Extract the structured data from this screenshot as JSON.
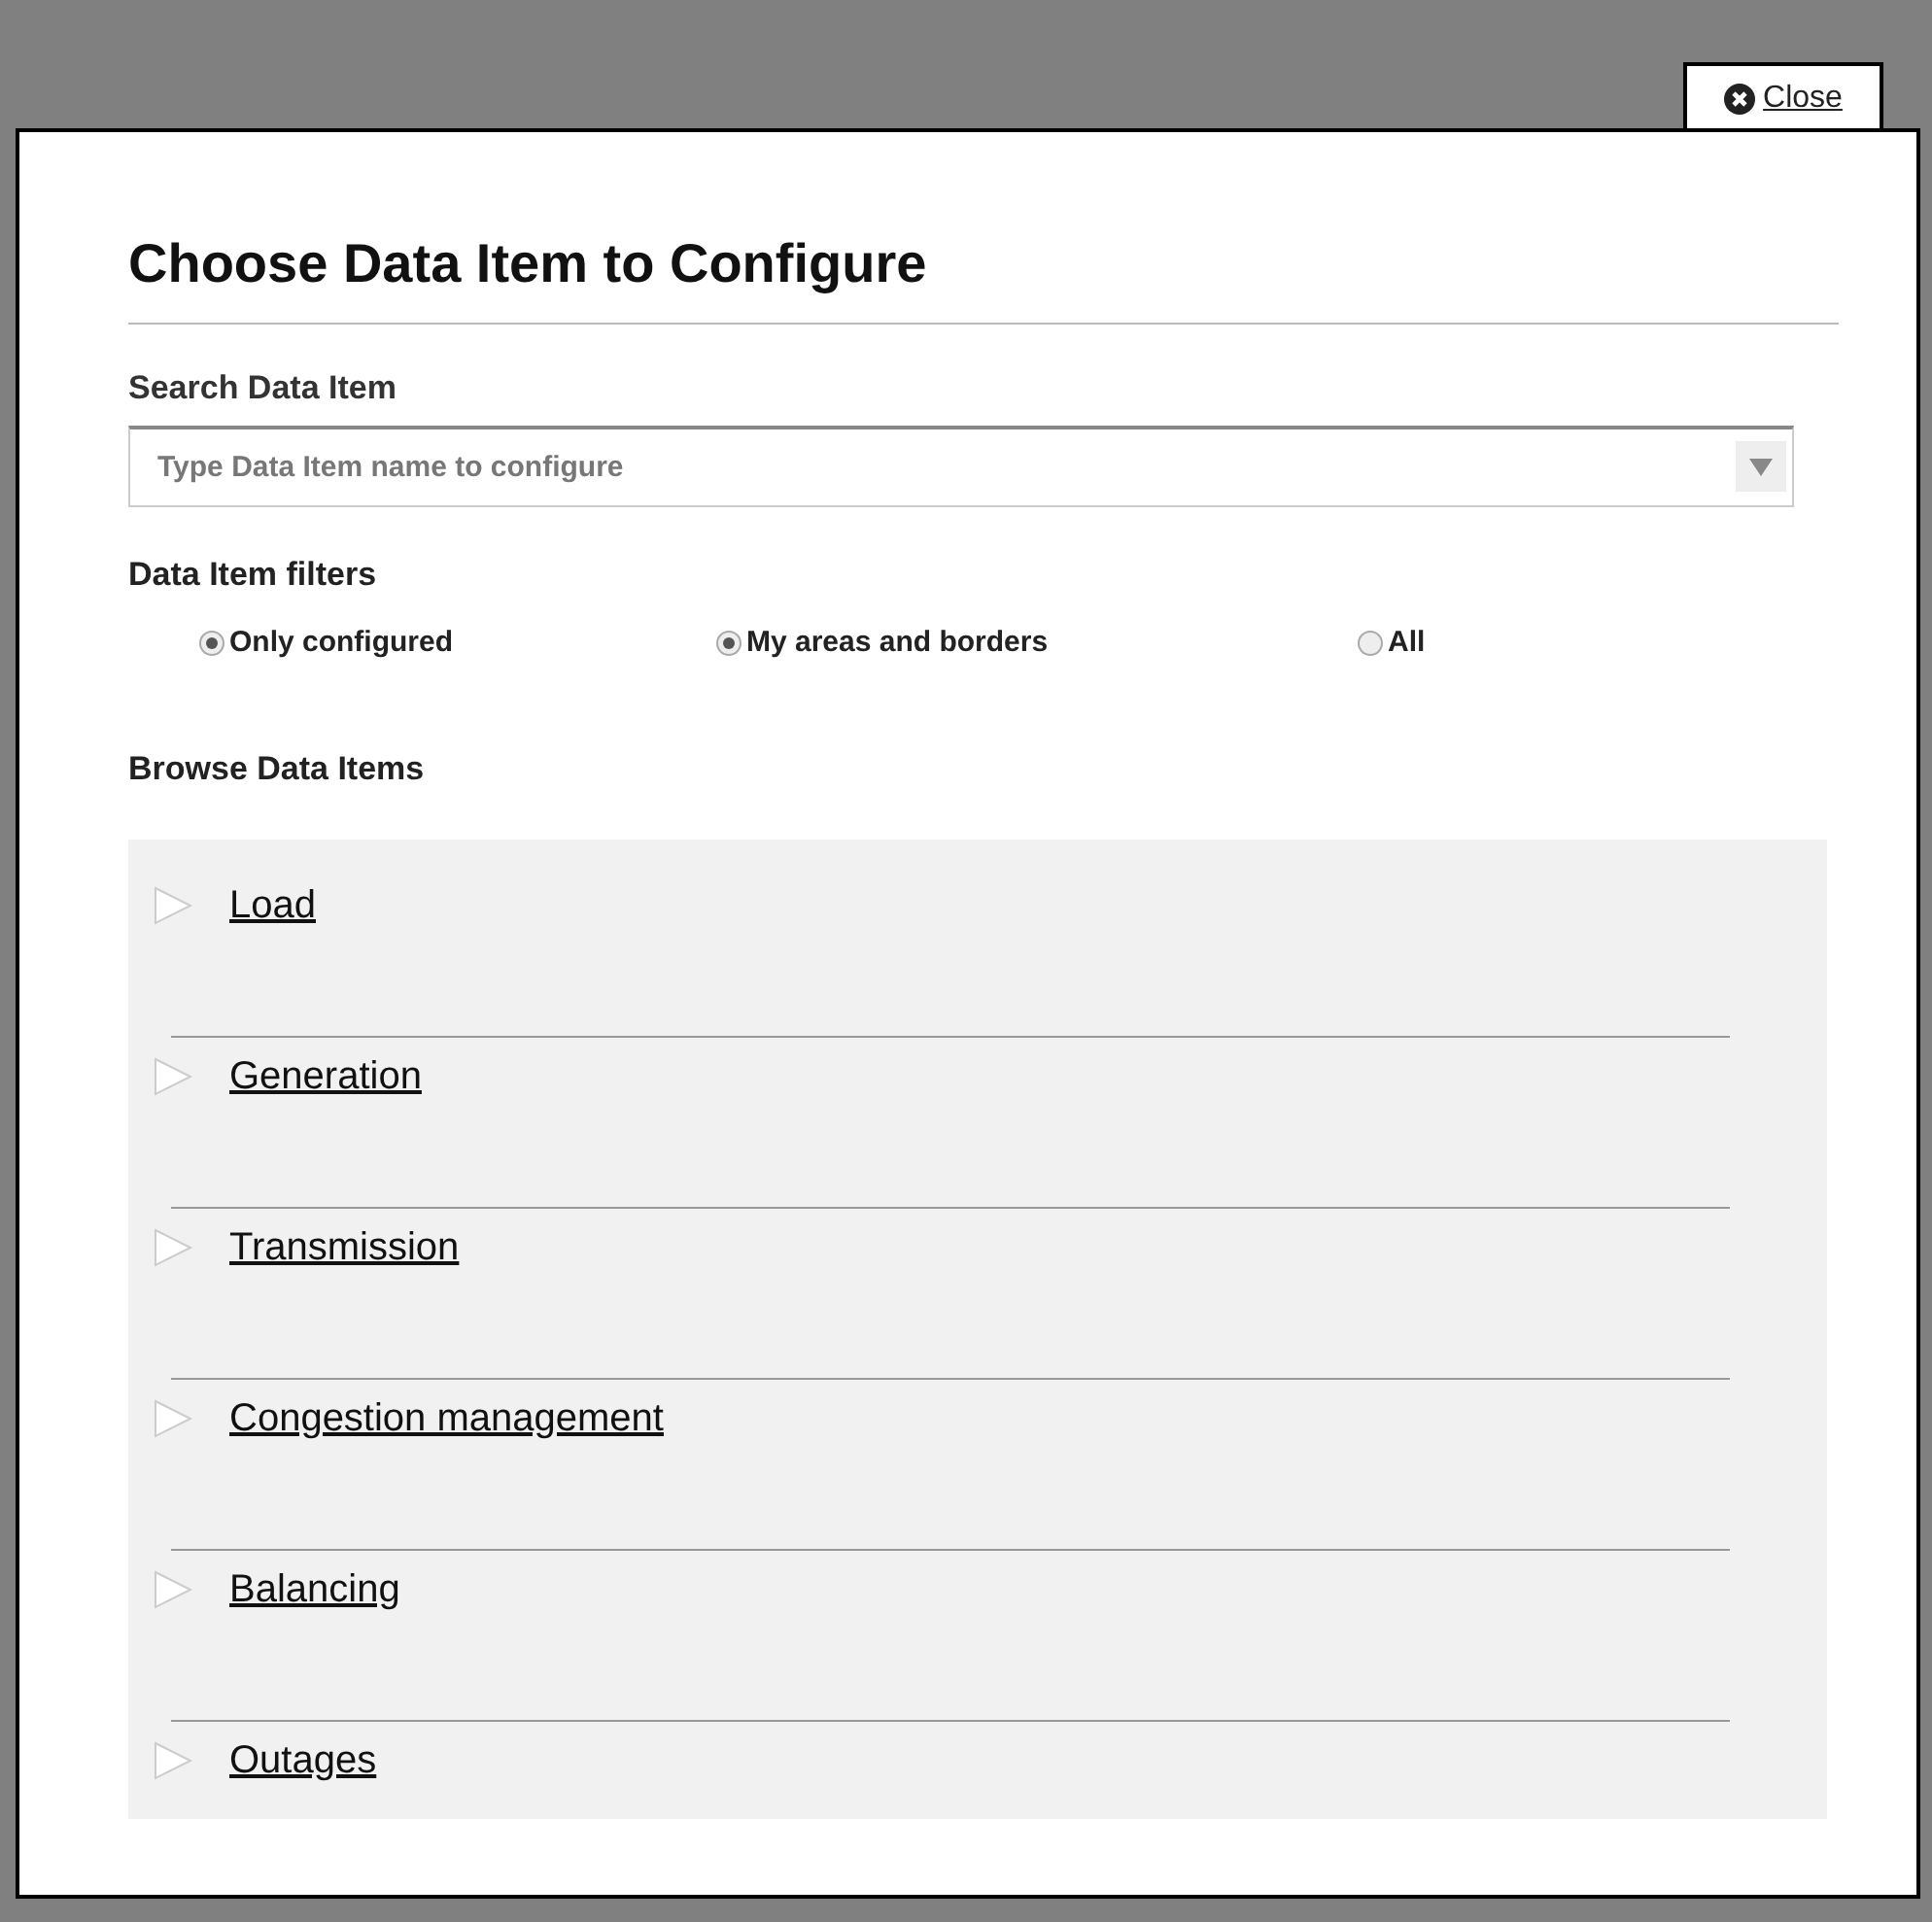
{
  "close_button": {
    "label": "Close"
  },
  "title": "Choose Data Item to Configure",
  "search": {
    "label": "Search Data Item",
    "placeholder": "Type Data Item name to configure"
  },
  "filters": {
    "label": "Data Item filters",
    "options": [
      {
        "label": "Only configured",
        "selected": true
      },
      {
        "label": "My areas and borders",
        "selected": true
      },
      {
        "label": "All",
        "selected": false
      }
    ]
  },
  "browse": {
    "label": "Browse Data Items",
    "items": [
      {
        "label": "Load",
        "expanded": false
      },
      {
        "label": "Generation",
        "expanded": false
      },
      {
        "label": "Transmission",
        "expanded": false
      },
      {
        "label": "Congestion management",
        "expanded": false
      },
      {
        "label": "Balancing",
        "expanded": false
      },
      {
        "label": "Outages",
        "expanded": false
      }
    ]
  }
}
